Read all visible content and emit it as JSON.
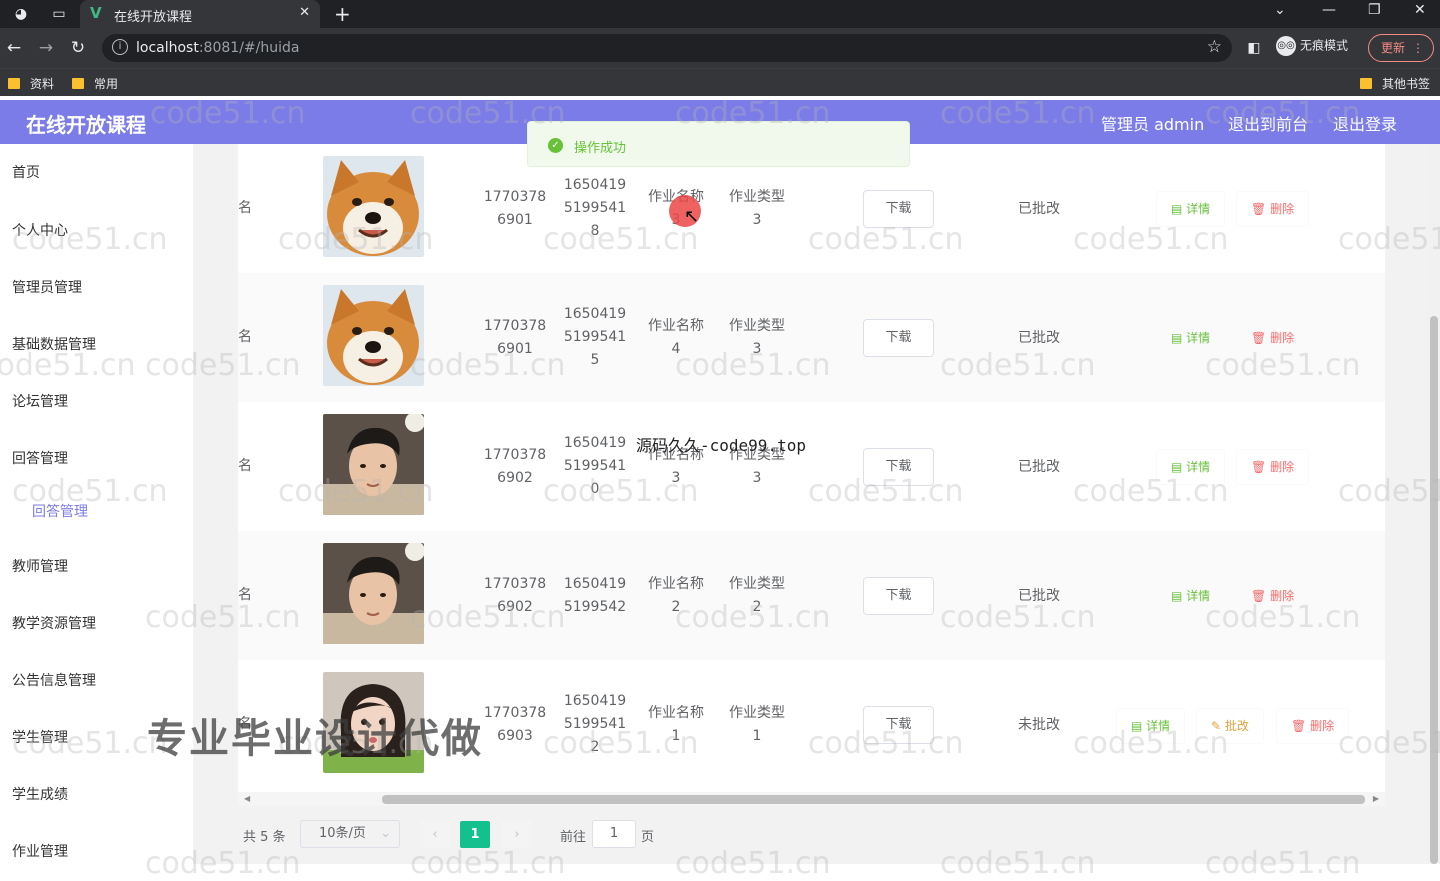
{
  "browser": {
    "tab_title": "在线开放课程",
    "url_host": "localhost",
    "url_rest": ":8081/#/huida",
    "incognito_label": "无痕模式",
    "update_label": "更新",
    "bookmarks": [
      "资料",
      "常用"
    ],
    "other_bookmarks": "其他书签"
  },
  "header": {
    "brand": "在线开放课程",
    "admin": "管理员 admin",
    "to_front": "退出到前台",
    "logout": "退出登录"
  },
  "toast": {
    "text": "操作成功"
  },
  "sidebar": {
    "items": [
      "首页",
      "个人中心",
      "管理员管理",
      "基础数据管理",
      "论坛管理",
      "回答管理",
      "教师管理",
      "教学资源管理",
      "公告信息管理",
      "学生管理",
      "学生成绩",
      "作业管理"
    ],
    "active_sub": "回答管理"
  },
  "table": {
    "download_label": "下载",
    "detail_label": "详情",
    "delete_label": "删除",
    "grade_label": "批改",
    "rows": [
      {
        "name": "姓名",
        "phone": "1770378\n6901",
        "idcard": "1650419\n5199541\n8",
        "task_name": "作业名称\n3",
        "task_type": "作业类型\n3",
        "status": "已批改",
        "avatar": "dog"
      },
      {
        "name": "姓名",
        "phone": "1770378\n6901",
        "idcard": "1650419\n5199541\n5",
        "task_name": "作业名称\n4",
        "task_type": "作业类型\n3",
        "status": "已批改",
        "avatar": "dog"
      },
      {
        "name": "姓名",
        "phone": "1770378\n6902",
        "idcard": "1650419\n5199541\n0",
        "task_name": "作业名称\n3",
        "task_type": "作业类型\n3",
        "status": "已批改",
        "avatar": "boy"
      },
      {
        "name": "姓名",
        "phone": "1770378\n6902",
        "idcard": "1650419\n5199542",
        "task_name": "作业名称\n2",
        "task_type": "作业类型\n2",
        "status": "已批改",
        "avatar": "boy"
      },
      {
        "name": "姓名",
        "phone": "1770378\n6903",
        "idcard": "1650419\n5199541\n2",
        "task_name": "作业名称\n1",
        "task_type": "作业类型\n1",
        "status": "未批改",
        "avatar": "girl"
      }
    ]
  },
  "pager": {
    "total": "共 5 条",
    "page_size": "10条/页",
    "current": "1",
    "goto_label": "前往",
    "goto_value": "1",
    "page_label": "页"
  },
  "watermarks": {
    "site": "code51.cn",
    "source": "源码久久-code99.top",
    "ad": "专业毕业设计代做"
  },
  "colors": {
    "header": "#7b7ce8",
    "success": "#67c23a",
    "danger": "#f56c6c",
    "warning": "#e6a23c",
    "pager_active": "#13c08e"
  }
}
